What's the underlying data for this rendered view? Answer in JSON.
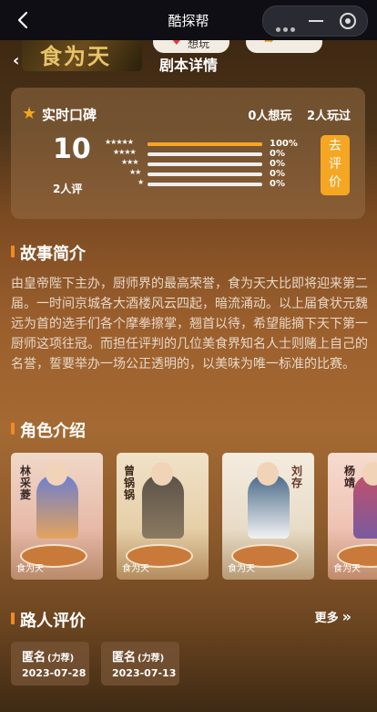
{
  "topbar": {
    "title": "酷探帮"
  },
  "header": {
    "poster_text": "食为天",
    "want_label": "想玩",
    "section_title": "剧本详情"
  },
  "rating": {
    "title": "实时口碑",
    "want_count": "0人想玩",
    "played_count": "2人玩过",
    "score": "10",
    "raters": "2人评",
    "distribution": [
      {
        "stars": 5,
        "percent": "100%",
        "fraction": 1.0
      },
      {
        "stars": 4,
        "percent": "0%",
        "fraction": 0
      },
      {
        "stars": 3,
        "percent": "0%",
        "fraction": 0
      },
      {
        "stars": 2,
        "percent": "0%",
        "fraction": 0
      },
      {
        "stars": 1,
        "percent": "0%",
        "fraction": 0
      }
    ],
    "rate_button": "去评价",
    "accent": "#f5a623"
  },
  "synopsis": {
    "title": "故事简介",
    "text": "由皇帝陛下主办，厨师界的最高荣誉，食为天大比即将迎来第二届。一时间京城各大酒楼风云四起，暗流涌动。以上届食状元魏远为首的选手们各个摩拳擦掌，翘首以待，希望能摘下天下第一厨师这项往冠。而担任评判的几位美食界知名人士则赌上自己的名誉，誓要举办一场公正透明的，以美味为唯一标准的比赛。"
  },
  "roles": {
    "title": "角色介绍",
    "items": [
      {
        "name": "林采菱",
        "brand": "食为天"
      },
      {
        "name": "曾锅锅",
        "brand": "食为天"
      },
      {
        "name": "刘存",
        "brand": "食为天"
      },
      {
        "name": "杨靖",
        "brand": "食为天"
      }
    ]
  },
  "reviews": {
    "title": "路人评价",
    "more_label": "更多",
    "items": [
      {
        "name": "匿名",
        "tag": "(力荐)",
        "date": "2023-07-28"
      },
      {
        "name": "匿名",
        "tag": "(力荐)",
        "date": "2023-07-13"
      }
    ]
  }
}
